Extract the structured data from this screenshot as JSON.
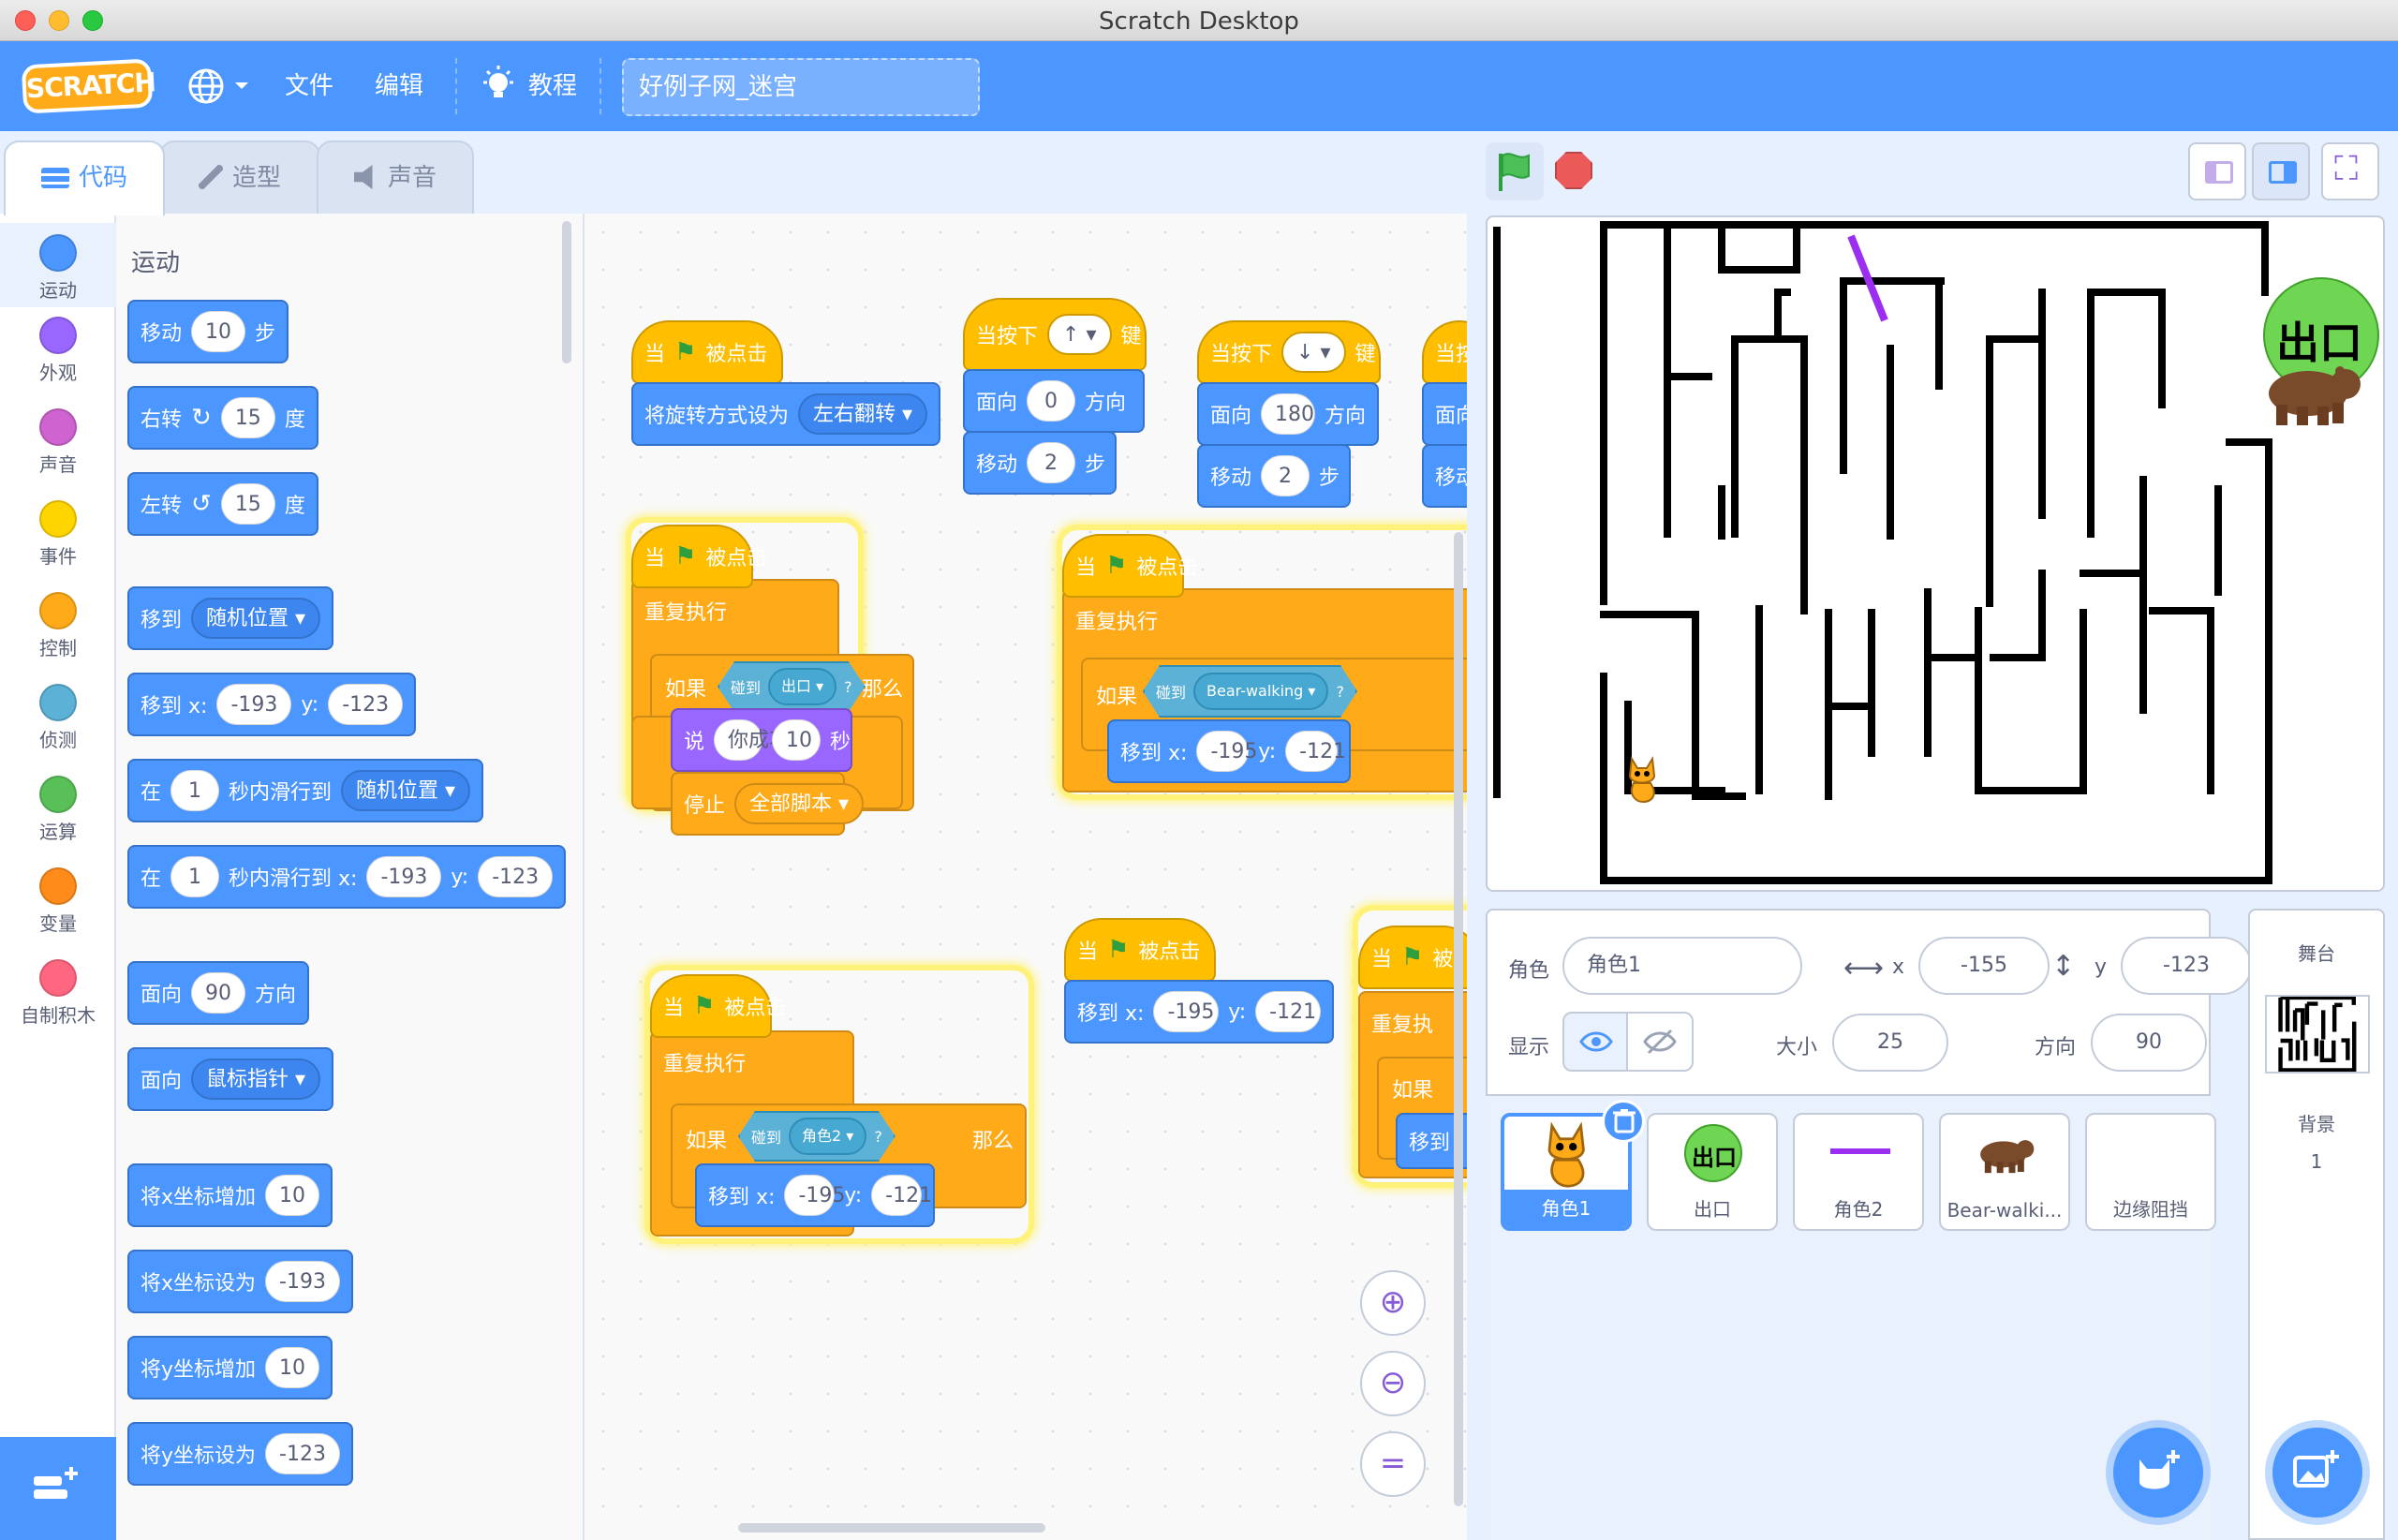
{
  "window": {
    "title": "Scratch Desktop"
  },
  "menubar": {
    "logo": "SCRATCH",
    "file": "文件",
    "edit": "编辑",
    "tutorials": "教程",
    "project_title": "好例子网_迷宫"
  },
  "tabs": {
    "code": "代码",
    "costumes": "造型",
    "sounds": "声音"
  },
  "categories": [
    {
      "label": "运动",
      "color": "#4c97ff"
    },
    {
      "label": "外观",
      "color": "#9966ff"
    },
    {
      "label": "声音",
      "color": "#cf63cf"
    },
    {
      "label": "事件",
      "color": "#ffd500"
    },
    {
      "label": "控制",
      "color": "#ffab19"
    },
    {
      "label": "侦测",
      "color": "#5cb1d6"
    },
    {
      "label": "运算",
      "color": "#59c059"
    },
    {
      "label": "变量",
      "color": "#ff8c1a"
    },
    {
      "label": "自制积木",
      "color": "#ff6680"
    }
  ],
  "palette": {
    "heading": "运动",
    "move": {
      "a": "移动",
      "v": "10",
      "b": "步"
    },
    "turn_right": {
      "a": "右转",
      "v": "15",
      "b": "度"
    },
    "turn_left": {
      "a": "左转",
      "v": "15",
      "b": "度"
    },
    "goto": {
      "a": "移到",
      "dd": "随机位置"
    },
    "goto_xy": {
      "a": "移到 x:",
      "x": "-193",
      "b": "y:",
      "y": "-123"
    },
    "glide": {
      "a": "在",
      "v": "1",
      "b": "秒内滑行到",
      "dd": "随机位置"
    },
    "glide_xy": {
      "a": "在",
      "v": "1",
      "b": "秒内滑行到 x:",
      "x": "-193",
      "c": "y:",
      "y": "-123"
    },
    "point_dir": {
      "a": "面向",
      "v": "90",
      "b": "方向"
    },
    "point_to": {
      "a": "面向",
      "dd": "鼠标指针"
    },
    "change_x": {
      "a": "将x坐标增加",
      "v": "10"
    },
    "set_x": {
      "a": "将x坐标设为",
      "v": "-193"
    },
    "change_y": {
      "a": "将y坐标增加",
      "v": "10"
    },
    "set_y": {
      "a": "将y坐标设为",
      "v": "-123"
    }
  },
  "scripts": {
    "when": "当",
    "clicked": "被点击",
    "rot_style": {
      "a": "将旋转方式设为",
      "dd": "左右翻转"
    },
    "key_up": {
      "a": "当按下",
      "dd": "↑",
      "b": "键"
    },
    "key_down": {
      "a": "当按下",
      "dd": "↓",
      "b": "键"
    },
    "key_cut": "当按",
    "face0": {
      "a": "面向",
      "v": "0",
      "b": "方向"
    },
    "face180": {
      "a": "面向",
      "v": "180",
      "b": "方向"
    },
    "face_cut": "面向",
    "move2": {
      "a": "移动",
      "v": "2",
      "b": "步"
    },
    "move_cut": "移动",
    "forever": "重复执行",
    "forever_cut": "重复执",
    "if": "如果",
    "then": "那么",
    "touching": "碰到",
    "q": "?",
    "exit": "出口",
    "bear": "Bear-walking",
    "sprite2": "角色2",
    "say": {
      "a": "说",
      "v": "你成功了!",
      "n": "10",
      "b": "秒"
    },
    "stop": {
      "a": "停止",
      "dd": "全部脚本"
    },
    "goto_xy": {
      "a": "移到 x:",
      "x": "-195",
      "b": "y:",
      "y": "-121"
    },
    "goto_cut": "移到",
    "when_cut": "被"
  },
  "stage": {
    "exit_label": "出口"
  },
  "sprite_info": {
    "sprite_label": "角色",
    "sprite_name": "角色1",
    "x_label": "x",
    "x": "-155",
    "y_label": "y",
    "y": "-123",
    "show_label": "显示",
    "size_label": "大小",
    "size": "25",
    "direction_label": "方向",
    "direction": "90"
  },
  "sprites": [
    {
      "name": "角色1",
      "selected": true
    },
    {
      "name": "出口"
    },
    {
      "name": "角色2"
    },
    {
      "name": "Bear-walki..."
    },
    {
      "name": "边缘阻挡"
    }
  ],
  "stage_pane": {
    "title": "舞台",
    "backdrop_label": "背景",
    "backdrop_count": "1"
  }
}
